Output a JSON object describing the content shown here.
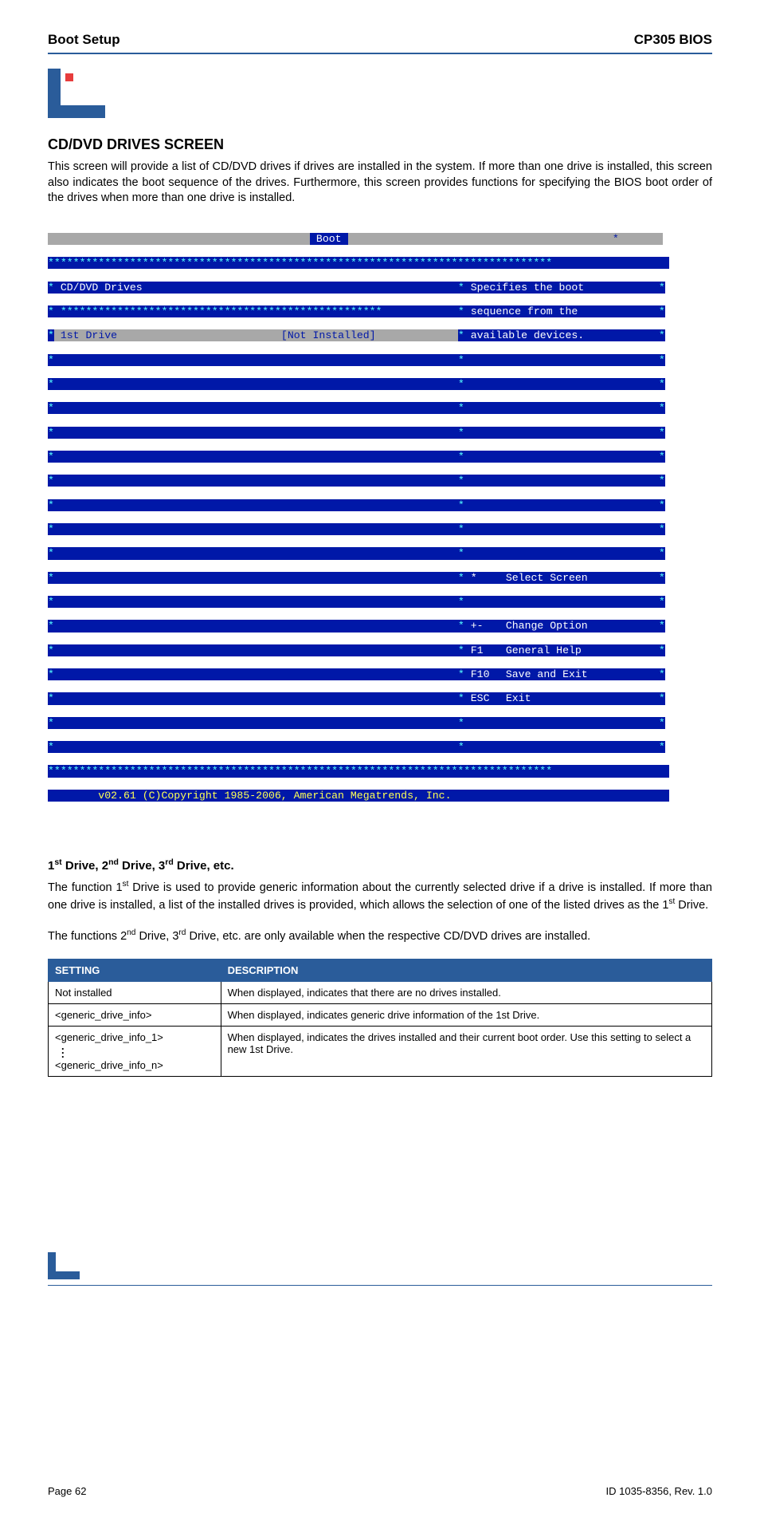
{
  "header": {
    "left": "Boot Setup",
    "right": "CP305 BIOS"
  },
  "section": {
    "title": "CD/DVD DRIVES SCREEN",
    "intro": "This screen will provide a list of CD/DVD drives if drives are installed in the system. If more than one drive is installed, this screen also indicates the boot sequence of the drives. Furthermore, this screen provides functions for specifying the BIOS boot order of the drives when more than one drive is installed."
  },
  "bios": {
    "tab": "Boot",
    "stars_full": "********************************************************************************",
    "left_title": " CD/DVD Drives",
    "left_stars": " ***************************************************",
    "first_drive_label": " 1st Drive",
    "first_drive_value": "[Not Installed]",
    "help_line1": " Specifies the boot",
    "help_line2": " sequence from the",
    "help_line3": " available devices.",
    "nav_select": "Select Screen",
    "nav_change": "Change Option",
    "nav_help": "General Help",
    "nav_save": "Save and Exit",
    "nav_exit": "Exit",
    "key_arrows": " *",
    "key_plusminus": " +-",
    "key_f1": " F1",
    "key_f10": " F10",
    "key_esc": " ESC",
    "footer": "        v02.61 (C)Copyright 1985-2006, American Megatrends, Inc.               "
  },
  "subsection": {
    "heading_html": "1st Drive, 2nd Drive, 3rd Drive, etc.",
    "p1_a": "The function 1",
    "p1_b": " Drive is used to provide generic information about the currently selected drive if a drive is installed. If more than one drive is installed, a list of the installed drives is provided, which allows the selection of one of the listed drives as the 1",
    "p1_c": " Drive.",
    "p2_a": "The functions 2",
    "p2_b": " Drive, 3",
    "p2_c": " Drive, etc. are only available when the respective CD/DVD drives are installed."
  },
  "table": {
    "head_setting": "SETTING",
    "head_desc": "DESCRIPTION",
    "rows": [
      {
        "setting": "Not installed",
        "desc": "When displayed, indicates that there are no drives installed."
      },
      {
        "setting": "<generic_drive_info>",
        "desc": "When displayed, indicates generic drive information of the 1st Drive."
      },
      {
        "setting_top": "<generic_drive_info_1>",
        "setting_bottom": "<generic_drive_info_n>",
        "desc": "When displayed, indicates the drives installed and their current boot order. Use this setting to select a new 1st Drive."
      }
    ]
  },
  "footer": {
    "left": "Page 62",
    "right": "ID 1035-8356, Rev. 1.0"
  }
}
